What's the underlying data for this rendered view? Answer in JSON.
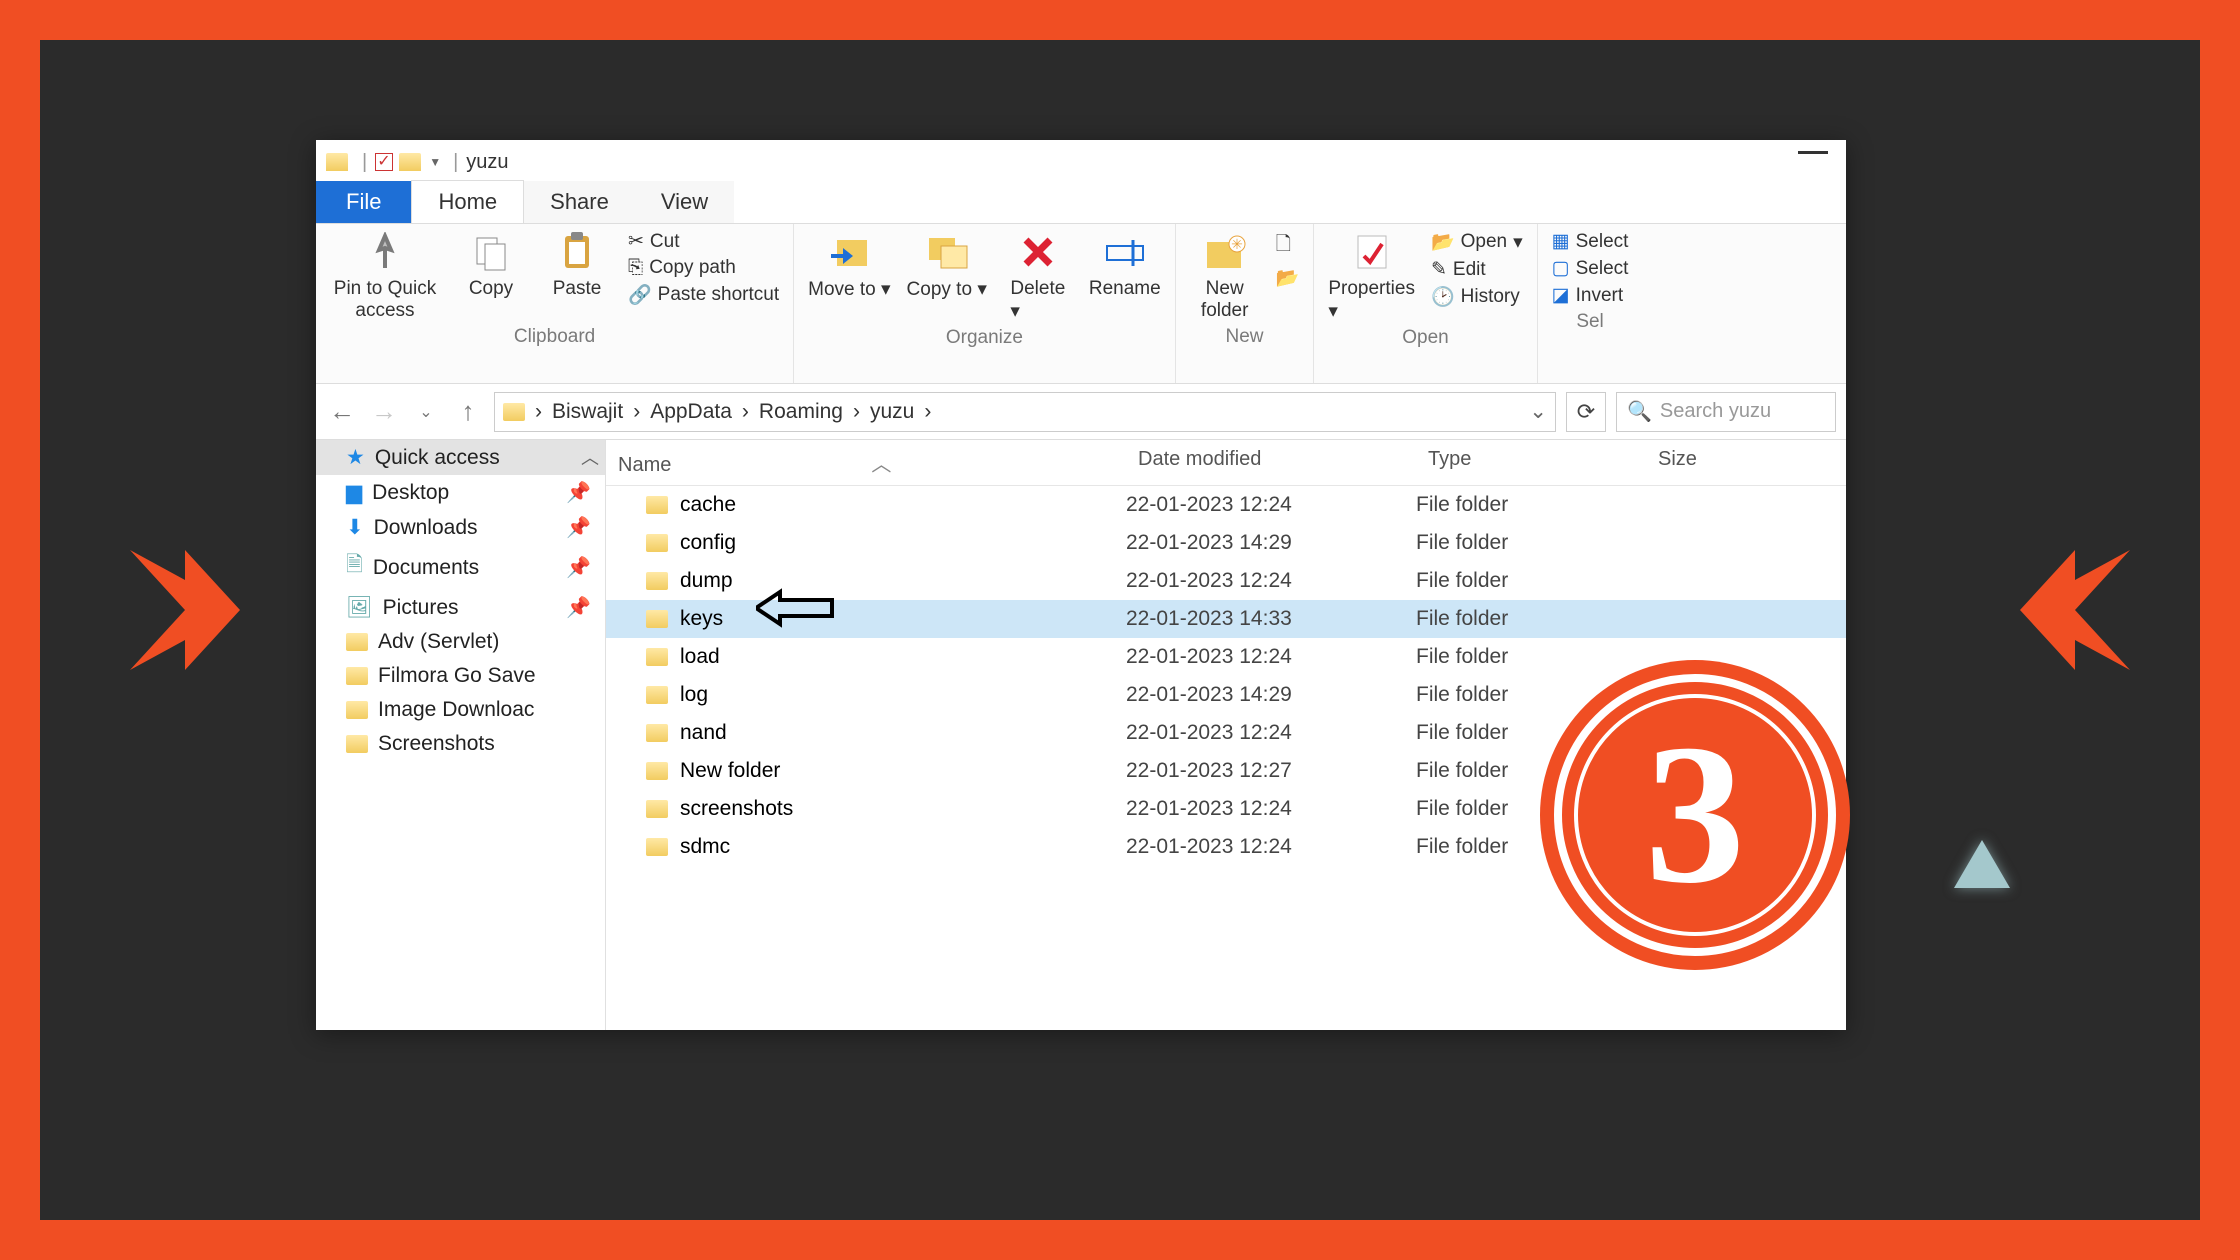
{
  "title": "yuzu",
  "tabs": {
    "file": "File",
    "home": "Home",
    "share": "Share",
    "view": "View"
  },
  "ribbon": {
    "clipboard": {
      "label": "Clipboard",
      "pin": "Pin to Quick access",
      "copy": "Copy",
      "paste": "Paste",
      "cut": "Cut",
      "copypath": "Copy path",
      "pasteshort": "Paste shortcut"
    },
    "organize": {
      "label": "Organize",
      "moveto": "Move to",
      "copyto": "Copy to",
      "delete": "Delete",
      "rename": "Rename"
    },
    "new": {
      "label": "New",
      "newfolder": "New folder"
    },
    "open": {
      "label": "Open",
      "properties": "Properties",
      "open": "Open",
      "edit": "Edit",
      "history": "History"
    },
    "select": {
      "label": "Sel",
      "all": "Select",
      "none": "Select",
      "invert": "Invert"
    }
  },
  "breadcrumb": [
    "Biswajit",
    "AppData",
    "Roaming",
    "yuzu"
  ],
  "search_placeholder": "Search yuzu",
  "columns": {
    "name": "Name",
    "date": "Date modified",
    "type": "Type",
    "size": "Size"
  },
  "sidebar": {
    "quick": "Quick access",
    "desktop": "Desktop",
    "downloads": "Downloads",
    "documents": "Documents",
    "pictures": "Pictures",
    "adv": "Adv (Servlet)",
    "filmora": "Filmora Go Save",
    "imgdl": "Image Downloac",
    "scr": "Screenshots"
  },
  "files": [
    {
      "name": "cache",
      "date": "22-01-2023 12:24",
      "type": "File folder"
    },
    {
      "name": "config",
      "date": "22-01-2023 14:29",
      "type": "File folder"
    },
    {
      "name": "dump",
      "date": "22-01-2023 12:24",
      "type": "File folder"
    },
    {
      "name": "keys",
      "date": "22-01-2023 14:33",
      "type": "File folder",
      "selected": true
    },
    {
      "name": "load",
      "date": "22-01-2023 12:24",
      "type": "File folder"
    },
    {
      "name": "log",
      "date": "22-01-2023 14:29",
      "type": "File folder"
    },
    {
      "name": "nand",
      "date": "22-01-2023 12:24",
      "type": "File folder"
    },
    {
      "name": "New folder",
      "date": "22-01-2023 12:27",
      "type": "File folder"
    },
    {
      "name": "screenshots",
      "date": "22-01-2023 12:24",
      "type": "File folder"
    },
    {
      "name": "sdmc",
      "date": "22-01-2023 12:24",
      "type": "File folder"
    }
  ],
  "step": "3",
  "caret_down": "▾",
  "chevron": "›"
}
